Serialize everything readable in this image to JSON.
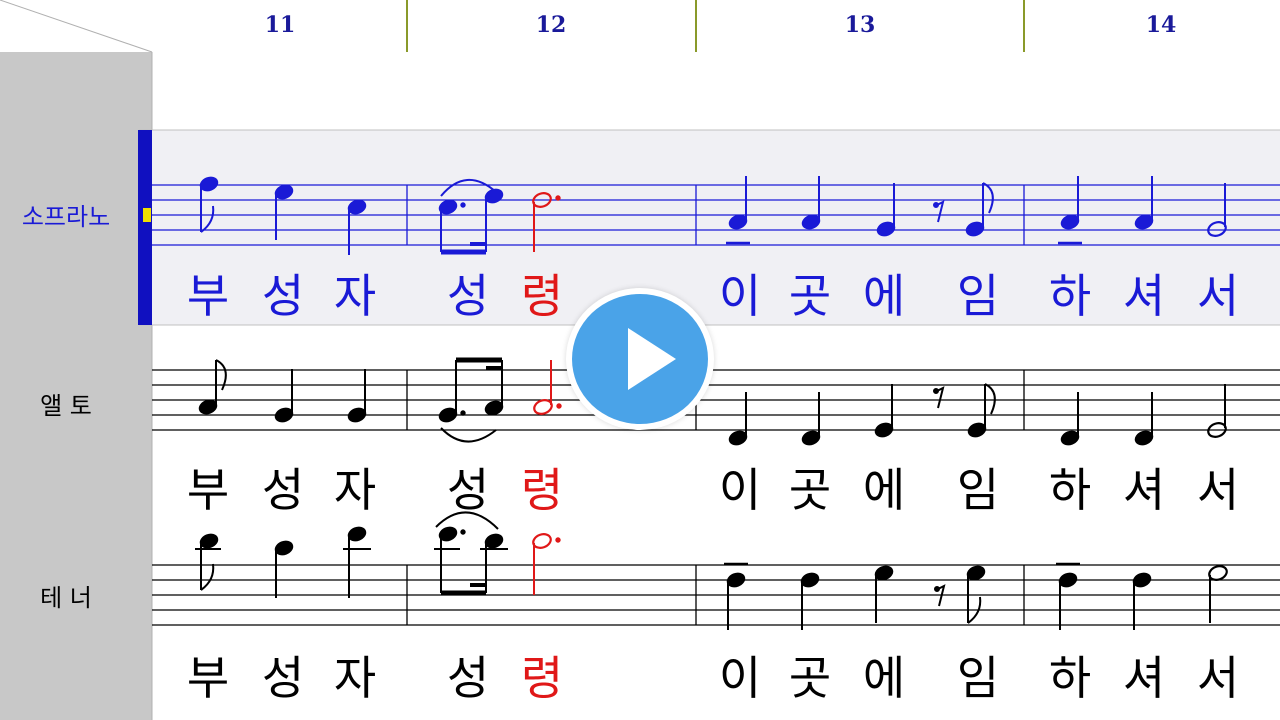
{
  "colors": {
    "active_part": "#1a1ad6",
    "current_note": "#e01818",
    "measure_header_rule": "#8a9a2a",
    "left_panel": "#c8c8c8",
    "active_band": "#f0f0f4",
    "cursor_bar": "#1010c0",
    "cursor_marker": "#f0e000",
    "play_button": "#4aa3e8",
    "ink": "#000000"
  },
  "measures": [
    "11",
    "12",
    "13",
    "14"
  ],
  "parts": [
    {
      "name": "소프라노",
      "active": true,
      "lyrics": [
        "부",
        "성",
        "자",
        "성",
        "령",
        "이",
        "곳",
        "에",
        "임",
        "하",
        "셔",
        "서"
      ],
      "current_index": 4
    },
    {
      "name": "앨 토",
      "active": false,
      "lyrics": [
        "부",
        "성",
        "자",
        "성",
        "령",
        "이",
        "곳",
        "에",
        "임",
        "하",
        "셔",
        "서"
      ],
      "current_index": 4
    },
    {
      "name": "테 너",
      "active": false,
      "lyrics": [
        "부",
        "성",
        "자",
        "성",
        "령",
        "이",
        "곳",
        "에",
        "임",
        "하",
        "셔",
        "서"
      ],
      "current_index": 4
    }
  ],
  "play_button": {
    "icon": "play-icon"
  }
}
